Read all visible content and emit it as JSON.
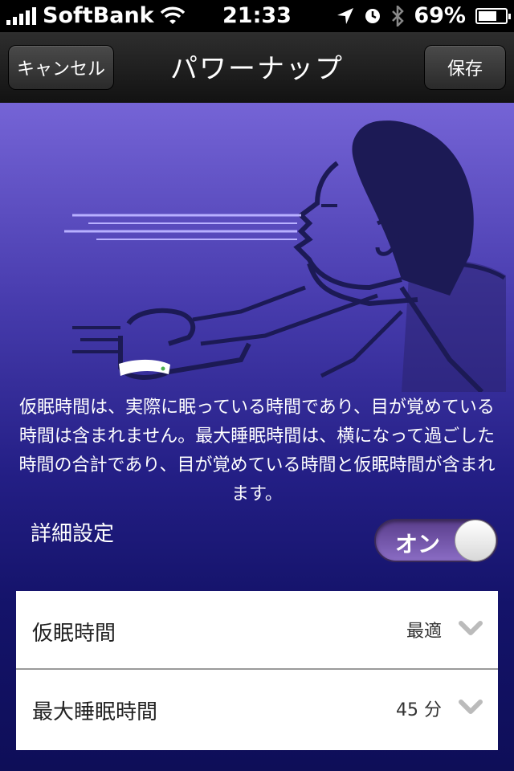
{
  "status_bar": {
    "carrier": "SoftBank",
    "time": "21:33",
    "battery": "69%",
    "battery_level": 0.69
  },
  "nav": {
    "cancel_label": "キャンセル",
    "title": "パワーナップ",
    "save_label": "保存"
  },
  "description": "仮眠時間は、実際に眠っている時間であり、目が覚めている時間は含まれません。最大睡眠時間は、横になって過ごした時間の合計であり、目が覚めている時間と仮眠時間が含まれます。",
  "advanced": {
    "label": "詳細設定",
    "toggle_label": "オン",
    "enabled": true
  },
  "settings": [
    {
      "label": "仮眠時間",
      "value": "最適"
    },
    {
      "label": "最大睡眠時間",
      "value": "45 分"
    }
  ],
  "icons": {
    "wifi": "wifi-icon",
    "location": "location-arrow-icon",
    "alarm": "alarm-clock-icon",
    "bluetooth": "bluetooth-icon",
    "battery": "battery-icon",
    "chevron": "chevron-down-icon"
  }
}
